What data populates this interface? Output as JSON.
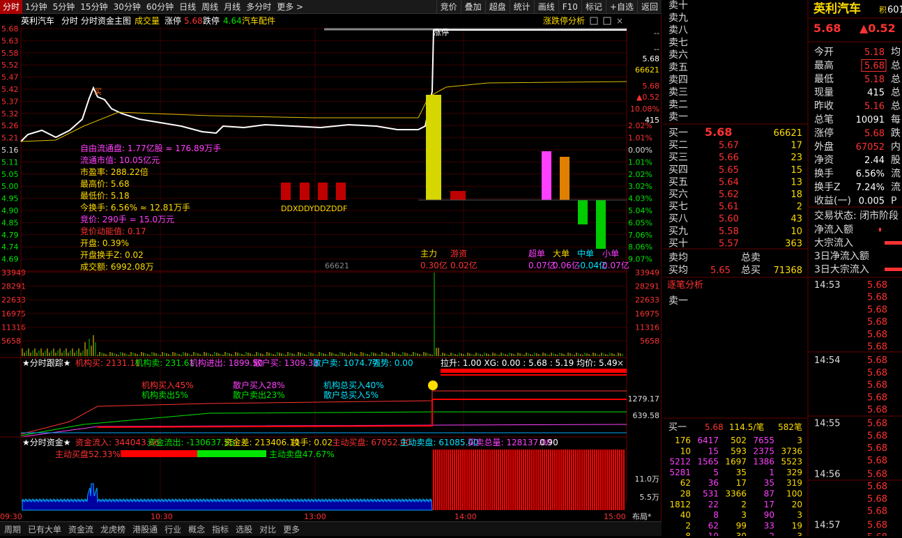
{
  "toolbar": {
    "periods": [
      "分时",
      "1分钟",
      "5分钟",
      "15分钟",
      "30分钟",
      "60分钟",
      "日线",
      "周线",
      "月线",
      "多分时",
      "更多 >"
    ],
    "actions": [
      "竞价",
      "叠加",
      "超盘",
      "统计",
      "画线",
      "F10",
      "标记",
      "+自选",
      "返回"
    ]
  },
  "info": {
    "name": "英利汽车",
    "mode": "分时",
    "main": "分时资金主图",
    "vol_label": "成交量",
    "limit_up_label": "涨停",
    "limit_up": "5.68",
    "limit_down_label": "跌停",
    "limit_down": "4.64",
    "sector": "汽车配件",
    "panel_title": "涨跌停分析"
  },
  "price_axis": [
    "5.68",
    "5.63",
    "5.58",
    "5.52",
    "5.47",
    "5.42",
    "5.37",
    "5.32",
    "5.26",
    "5.21",
    "5.16",
    "5.11",
    "5.05",
    "5.00",
    "4.95",
    "4.90",
    "4.85",
    "4.79",
    "4.74",
    "4.69"
  ],
  "pct_axis": [
    "",
    "",
    "",
    "",
    "",
    "",
    "",
    "",
    "2.02%",
    "1.01%",
    "0.00%",
    "1.01%",
    "2.02%",
    "3.02%",
    "4.03%",
    "5.04%",
    "6.05%",
    "7.06%",
    "8.06%",
    "9.07%"
  ],
  "right_tags": {
    "t1": "--",
    "t2": "--",
    "t3": "5.68",
    "t4": "66621",
    "t5": "5.68",
    "t6": "▲0.52",
    "t7": "10.08%",
    "t8": "415"
  },
  "stats": [
    {
      "k": "自由流通盘:",
      "v": "1.77亿股 ≈ 176.89万手",
      "c": "mag"
    },
    {
      "k": "流通市值:",
      "v": "10.05亿元",
      "c": "mag"
    },
    {
      "k": "市盈率:",
      "v": "288.22倍",
      "c": "yellow"
    },
    {
      "k": "最高价:",
      "v": "5.68",
      "c": "yellow"
    },
    {
      "k": "最低价:",
      "v": "5.18",
      "c": "yellow"
    },
    {
      "k": "今换手:",
      "v": "6.56% ≈ 12.81万手",
      "c": "yellow"
    },
    {
      "k": "竞价:",
      "v": "290手 = 15.0万元",
      "c": "mag"
    },
    {
      "k": "竞价动能值:",
      "v": "0.17",
      "c": "red"
    },
    {
      "k": "开盘:",
      "v": "0.39%",
      "c": "yellow"
    },
    {
      "k": "开盘换手Z:",
      "v": "0.02",
      "c": "yellow"
    },
    {
      "k": "成交额:",
      "v": "6992.08万",
      "c": "yellow"
    }
  ],
  "ddx_label": "DDXDDYDDZDDF",
  "vol_marker": "66621",
  "flow": {
    "labels": [
      "主力",
      "游资",
      "超单",
      "大单",
      "中单",
      "小单"
    ],
    "values": [
      "0.30亿",
      "0.02亿",
      "0.07亿",
      "0.06亿",
      "-0.04亿",
      "0.07亿"
    ]
  },
  "vol_axis": [
    "33949",
    "28291",
    "22633",
    "16975",
    "11316",
    "5658"
  ],
  "vol_axis_right": [
    "33949",
    "28291",
    "22633",
    "16975",
    "11316",
    "5658"
  ],
  "tracker": {
    "title": "★分时跟踪★",
    "items": [
      {
        "k": "机构买:",
        "v": "2131.11",
        "c": "red"
      },
      {
        "k": "机构卖:",
        "v": "231.61",
        "c": "green"
      },
      {
        "k": "机构进出:",
        "v": "1899.50",
        "c": "mag"
      },
      {
        "k": "散户买:",
        "v": "1309.33",
        "c": "mag"
      },
      {
        "k": "散户卖:",
        "v": "1074.77",
        "c": "cyan"
      },
      {
        "k": "强势:",
        "v": "0.00",
        "c": "cyan"
      }
    ],
    "extra": "拉升: 1.00  XG: 0.00  : 5.68 : 5.19  均价: 5.49",
    "legend1a": "机构买入45%",
    "legend1b": "机构卖出5%",
    "legend2a": "散户买入28%",
    "legend2b": "散户卖出23%",
    "legend3a": "机构总买入40%",
    "legend3b": "散户总买入5%",
    "axis": [
      "1279.17",
      "639.58"
    ]
  },
  "capital": {
    "title": "★分时资金★",
    "items": [
      {
        "k": "资金流入:",
        "v": "344043.66",
        "c": "red"
      },
      {
        "k": "资金流出:",
        "v": "-130637.55",
        "c": "green"
      },
      {
        "k": "资金差:",
        "v": "213406.11",
        "c": "yellow"
      },
      {
        "k": "换手:",
        "v": "0.02",
        "c": "yellow"
      },
      {
        "k": "主动买盘:",
        "v": "67052.00",
        "c": "red"
      },
      {
        "k": "主动卖盘:",
        "v": "61085.00",
        "c": "cyan"
      },
      {
        "k": "买卖总量:",
        "v": "128137.00",
        "c": "mag"
      },
      {
        "k": "",
        "v": "0.90",
        "c": "white"
      }
    ],
    "buy_pct": "主动买盘52.33%",
    "sell_pct": "主动卖盘47.67%",
    "axis": [
      "11.0万",
      "5.5万"
    ]
  },
  "time_axis": [
    "09:30",
    "10:30",
    "13:00",
    "14:00",
    "15:00"
  ],
  "layout_btn": "布局*",
  "bottom_tabs": [
    "周期",
    "已有大单",
    "资金流",
    "龙虎榜",
    "港股通",
    "行业",
    "概念",
    "指标",
    "选股",
    "对比",
    "更多"
  ],
  "stock": {
    "name": "英利汽车",
    "code": "601",
    "tag": "积",
    "price": "5.68",
    "change": "▲0.52"
  },
  "sell_levels": [
    "卖十",
    "卖九",
    "卖八",
    "卖七",
    "卖六",
    "卖五",
    "卖四",
    "卖三",
    "卖二",
    "卖一"
  ],
  "buy_levels": [
    {
      "l": "买一",
      "p": "5.68",
      "v": "66621"
    },
    {
      "l": "买二",
      "p": "5.67",
      "v": "17"
    },
    {
      "l": "买三",
      "p": "5.66",
      "v": "23"
    },
    {
      "l": "买四",
      "p": "5.65",
      "v": "15"
    },
    {
      "l": "买五",
      "p": "5.64",
      "v": "13"
    },
    {
      "l": "买六",
      "p": "5.62",
      "v": "18"
    },
    {
      "l": "买七",
      "p": "5.61",
      "v": "2"
    },
    {
      "l": "买八",
      "p": "5.60",
      "v": "43"
    },
    {
      "l": "买九",
      "p": "5.58",
      "v": "10"
    },
    {
      "l": "买十",
      "p": "5.57",
      "v": "363"
    }
  ],
  "avg": {
    "sell_avg": "卖均",
    "sell_total": "总卖",
    "buy_avg": "买均",
    "buy_avg_v": "5.65",
    "buy_total": "总买",
    "buy_total_v": "71368"
  },
  "quote": [
    {
      "k": "今开",
      "v": "5.18"
    },
    {
      "k": "最高",
      "v": "5.68"
    },
    {
      "k": "最低",
      "v": "5.18"
    },
    {
      "k": "现量",
      "v": "415"
    },
    {
      "k": "昨收",
      "v": "5.16"
    },
    {
      "k": "总笔",
      "v": "10091"
    },
    {
      "k": "涨停",
      "v": "5.68"
    },
    {
      "k": "外盘",
      "v": "67052"
    },
    {
      "k": "净资",
      "v": "2.44"
    },
    {
      "k": "换手",
      "v": "6.56%"
    },
    {
      "k": "换手Z",
      "v": "7.24%"
    },
    {
      "k": "收益(一)",
      "v": "0.005"
    }
  ],
  "quote_tail": [
    "均",
    "总",
    "总",
    "总",
    "总",
    "每",
    "跌",
    "内",
    "股",
    "流",
    "流",
    "P"
  ],
  "status": "交易状态: 闭市阶段",
  "flows": [
    "净流入额",
    "大宗流入",
    "3日净流入额",
    "3日大宗流入"
  ],
  "tick_title": "逐笔分析",
  "tick_sell1": "卖一",
  "ticks": [
    {
      "t": "14:53",
      "p": "5.68"
    },
    {
      "t": "",
      "p": "5.68"
    },
    {
      "t": "",
      "p": "5.68"
    },
    {
      "t": "",
      "p": "5.68"
    },
    {
      "t": "",
      "p": "5.68"
    },
    {
      "t": "",
      "p": "5.68"
    },
    {
      "t": "14:54",
      "p": "5.68"
    },
    {
      "t": "",
      "p": "5.68"
    },
    {
      "t": "",
      "p": "5.68"
    },
    {
      "t": "",
      "p": "5.68"
    },
    {
      "t": "",
      "p": "5.68"
    },
    {
      "t": "14:55",
      "p": "5.68"
    },
    {
      "t": "",
      "p": "5.68"
    },
    {
      "t": "",
      "p": "5.68"
    },
    {
      "t": "",
      "p": "5.68"
    },
    {
      "t": "14:56",
      "p": "5.68"
    },
    {
      "t": "",
      "p": "5.68"
    },
    {
      "t": "",
      "p": "5.68"
    },
    {
      "t": "",
      "p": "5.68"
    },
    {
      "t": "14:57",
      "p": "5.68"
    },
    {
      "t": "",
      "p": "5.68"
    }
  ],
  "queue_head": {
    "l": "买一",
    "p": "5.68",
    "a": "114.5/笔",
    "n": "582笔"
  },
  "queue": [
    [
      "176",
      "6417",
      "502",
      "7655",
      "3"
    ],
    [
      "10",
      "15",
      "593",
      "2375",
      "3736"
    ],
    [
      "5212",
      "1565",
      "1697",
      "1386",
      "5523"
    ],
    [
      "5281",
      "5",
      "35",
      "1",
      "329"
    ],
    [
      "62",
      "36",
      "17",
      "35",
      "319"
    ],
    [
      "28",
      "531",
      "3366",
      "87",
      "100"
    ],
    [
      "1812",
      "22",
      "2",
      "17",
      "20"
    ],
    [
      "40",
      "8",
      "3",
      "90",
      "3"
    ],
    [
      "2",
      "62",
      "99",
      "33",
      "19"
    ],
    [
      "8",
      "19",
      "30",
      "2",
      "3"
    ]
  ]
}
